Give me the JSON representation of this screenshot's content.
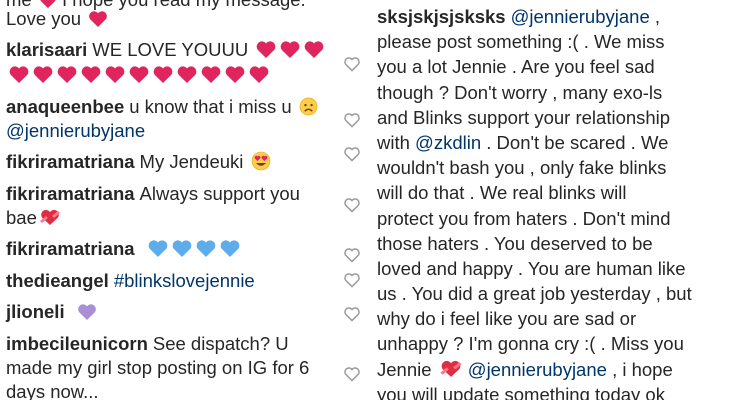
{
  "left_comments": [
    {
      "id": "c0",
      "lines": [
        "me",
        "Love you"
      ],
      "partial_text": "I hope you read my message."
    },
    {
      "id": "klarisaari",
      "username": "klarisaari",
      "text": "WE LOVE YOUUU",
      "emoji": "red-heart"
    },
    {
      "id": "anaqueenbee",
      "username": "anaqueenbee",
      "text": "u know that i miss u",
      "emoji": "disappointed-face",
      "mention": "@jennierubyjane"
    },
    {
      "id": "fik1",
      "username": "fikriramatriana",
      "text": "My Jendeuki",
      "emoji": "heart-eyes"
    },
    {
      "id": "fik2",
      "username": "fikriramatriana",
      "text": "Always support you",
      "text2": "bae",
      "emoji": "heart-ribbon"
    },
    {
      "id": "fik3",
      "username": "fikriramatriana",
      "emoji": "blue-heart"
    },
    {
      "id": "thedieangel",
      "username": "thedieangel",
      "hashtag": "#blinkslovejennie"
    },
    {
      "id": "jlioneli",
      "username": "jlioneli",
      "emoji": "purple-heart"
    },
    {
      "id": "imbecileunicorn",
      "username": "imbecileunicorn",
      "text1": "See dispatch? U",
      "text2": "made my girl stop posting on IG for 6",
      "text3": "days now..."
    }
  ],
  "right_comment": {
    "username": "sksjskjsjsksks",
    "mention_1": "@jennierubyjane",
    "line_1_suffix": ",",
    "lines": [
      "please post something :( . We miss",
      "you a lot Jennie . Are you feel sad",
      "though ? Don't worry , many exo-ls",
      "and Blinks support your relationship"
    ],
    "line_6_prefix": "with",
    "mention_2": "@zkdlin",
    "line_6_suffix": ". Don't be scared . We",
    "lines_b": [
      "wouldn't bash you , only fake blinks",
      "will do that . We real blinks will",
      "protect you from haters . Don't mind",
      "those haters . You deserved to be",
      "loved and happy . You are human like",
      "us . You did a great job yesterday , but",
      "why do i feel like you are sad or",
      "unhappy ? I'm gonna cry :( . Miss you"
    ],
    "line_15_prefix": "Jennie",
    "mention_3": "@jennierubyjane",
    "line_15_suffix": ", i hope",
    "line_16_partial": "you will update something today ok",
    "emoji_inline": "heart-ribbon"
  },
  "colors": {
    "text": "#262626",
    "link": "#003569",
    "like_icon": "#999999",
    "heart_red": "#e0245e",
    "heart_blue": "#5dadec",
    "heart_purple": "#aa8ed6"
  }
}
